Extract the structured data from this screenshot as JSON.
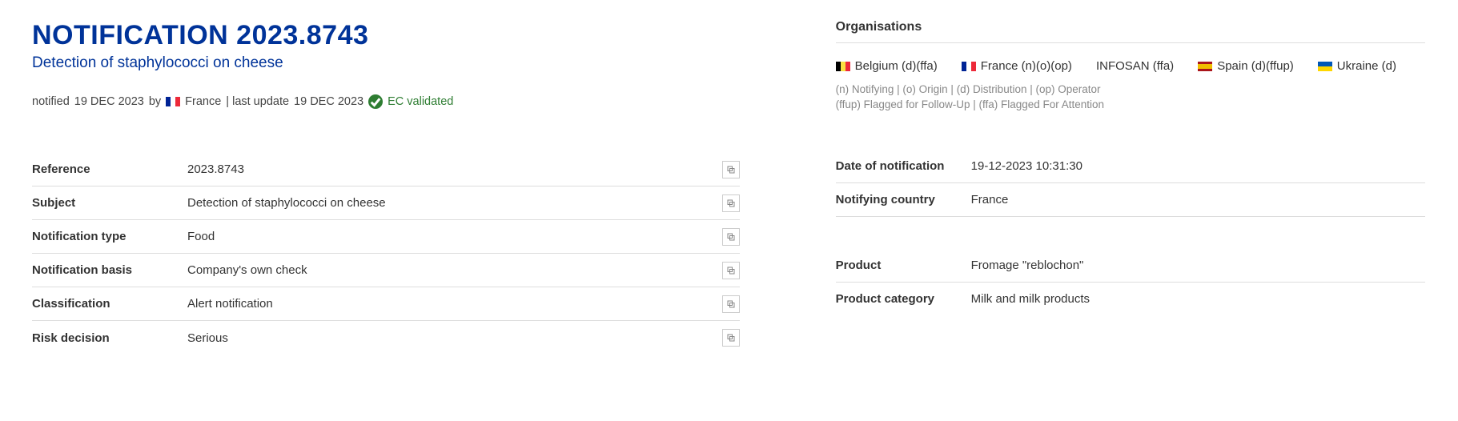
{
  "header": {
    "title": "NOTIFICATION 2023.8743",
    "subtitle": "Detection of staphylococci on cheese",
    "meta_prefix": "notified",
    "meta_date": "19 DEC 2023",
    "meta_by": "by",
    "meta_country": "France",
    "meta_update_prefix": "| last update",
    "meta_update_date": "19 DEC 2023",
    "validated": "EC validated"
  },
  "left_fields": {
    "reference": {
      "label": "Reference",
      "value": "2023.8743"
    },
    "subject": {
      "label": "Subject",
      "value": "Detection of staphylococci on cheese"
    },
    "notification_type": {
      "label": "Notification type",
      "value": "Food"
    },
    "notification_basis": {
      "label": "Notification basis",
      "value": "Company's own check"
    },
    "classification": {
      "label": "Classification",
      "value": "Alert notification"
    },
    "risk_decision": {
      "label": "Risk decision",
      "value": "Serious"
    }
  },
  "organisations": {
    "heading": "Organisations",
    "items": [
      {
        "flag": "be",
        "text": "Belgium (d)(ffa)"
      },
      {
        "flag": "fr",
        "text": "France (n)(o)(op)"
      },
      {
        "flag": null,
        "text": "INFOSAN (ffa)"
      },
      {
        "flag": "es",
        "text": "Spain (d)(ffup)"
      },
      {
        "flag": "ua",
        "text": "Ukraine (d)"
      }
    ],
    "legend1": "(n) Notifying | (o) Origin | (d) Distribution | (op) Operator",
    "legend2": "(ffup) Flagged for Follow-Up | (ffa) Flagged For Attention"
  },
  "right_fields": {
    "date_notif": {
      "label": "Date of notification",
      "value": "19-12-2023 10:31:30"
    },
    "notif_country": {
      "label": "Notifying country",
      "value": "France"
    },
    "product": {
      "label": "Product",
      "value": "Fromage \"reblochon\""
    },
    "product_cat": {
      "label": "Product category",
      "value": "Milk and milk products"
    }
  }
}
